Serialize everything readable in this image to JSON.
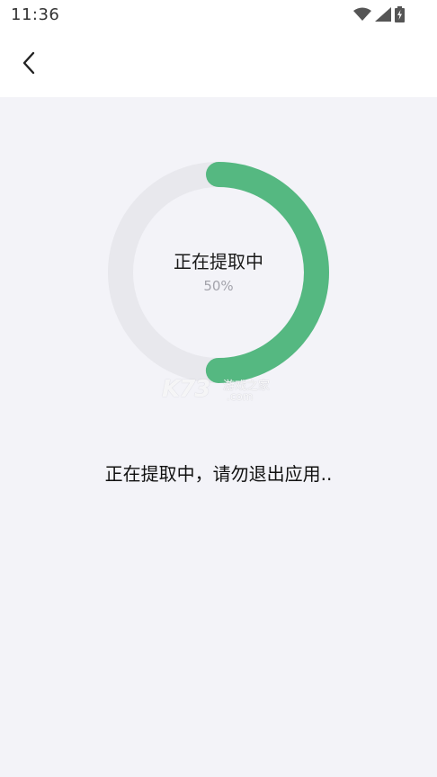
{
  "status_bar": {
    "time": "11:36",
    "icons": [
      "wifi-icon",
      "cellular-signal-icon",
      "battery-charging-icon"
    ]
  },
  "app_bar": {
    "back_icon": "chevron-left-icon"
  },
  "progress": {
    "title": "正在提取中",
    "percent_label": "50%",
    "fraction": 0.5,
    "track_color": "#e8e8ed",
    "fill_color": "#55b881"
  },
  "watermark": {
    "brand": "K73",
    "name": "游戏之家",
    "domain": ".com"
  },
  "message": "正在提取中，请勿退出应用.."
}
